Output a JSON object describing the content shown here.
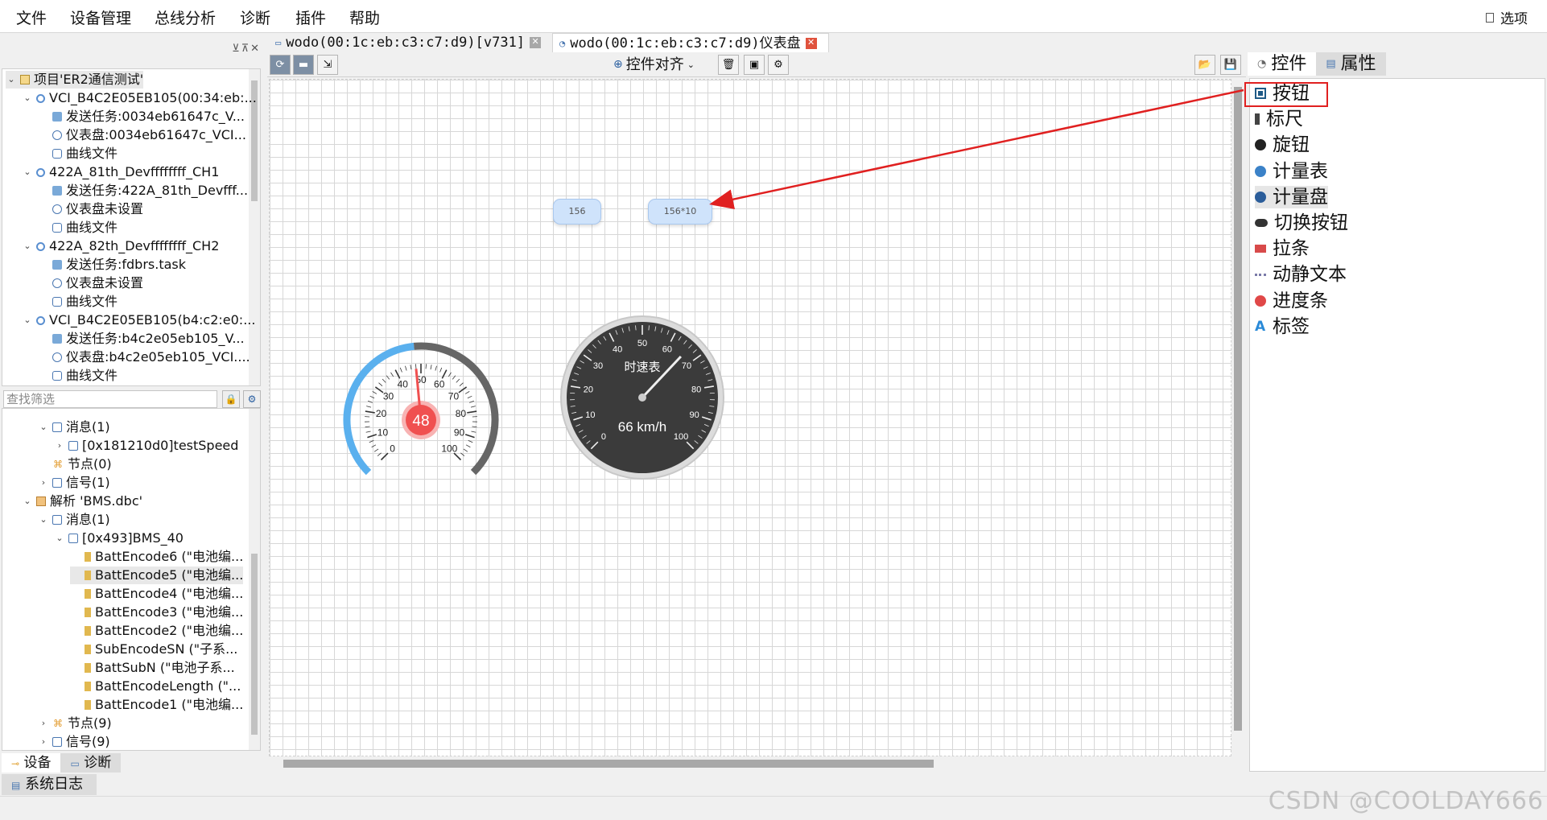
{
  "menu": [
    "文件",
    "设备管理",
    "总线分析",
    "诊断",
    "插件",
    "帮助"
  ],
  "menu_right": "选项",
  "tree_top": [
    {
      "label": "项目'ER2通信测试'",
      "icon": "folder-icon"
    },
    {
      "label": "VCI_B4C2E05EB105(00:34:eb:...",
      "icon": "link-icon"
    },
    {
      "label": "发送任务:0034eb61647c_V...",
      "icon": "task-icon"
    },
    {
      "label": "仪表盘:0034eb61647c_VCI...",
      "icon": "dashboard-icon"
    },
    {
      "label": "曲线文件",
      "icon": "curve-icon"
    },
    {
      "label": "422A_81th_Devffffffff_CH1",
      "icon": "link-icon"
    },
    {
      "label": "发送任务:422A_81th_Devfff...",
      "icon": "task-icon"
    },
    {
      "label": "仪表盘未设置",
      "icon": "dashboard-icon"
    },
    {
      "label": "曲线文件",
      "icon": "curve-icon"
    },
    {
      "label": "422A_82th_Devffffffff_CH2",
      "icon": "link-icon"
    },
    {
      "label": "发送任务:fdbrs.task",
      "icon": "task-icon"
    },
    {
      "label": "仪表盘未设置",
      "icon": "dashboard-icon"
    },
    {
      "label": "曲线文件",
      "icon": "curve-icon"
    },
    {
      "label": "VCI_B4C2E05EB105(b4:c2:e0:...",
      "icon": "link-icon"
    },
    {
      "label": "发送任务:b4c2e05eb105_V...",
      "icon": "task-icon"
    },
    {
      "label": "仪表盘:b4c2e05eb105_VCI....",
      "icon": "dashboard-icon"
    },
    {
      "label": "曲线文件",
      "icon": "curve-icon"
    }
  ],
  "filter_placeholder": "查找筛选",
  "tree_bottom": [
    {
      "label": "消息(1)",
      "icon": "message-icon"
    },
    {
      "label": "[0x181210d0]testSpeed",
      "icon": "envelope-icon"
    },
    {
      "label": "节点(0)",
      "icon": "node-icon"
    },
    {
      "label": "信号(1)",
      "icon": "envelope-icon"
    },
    {
      "label": "解析 'BMS.dbc'",
      "icon": "dbc-icon"
    },
    {
      "label": "消息(1)",
      "icon": "message-icon"
    },
    {
      "label": "[0x493]BMS_40",
      "icon": "envelope-icon"
    },
    {
      "label": "BattEncode6 (\"电池编...",
      "icon": "signal-icon"
    },
    {
      "label": "BattEncode5 (\"电池编...",
      "icon": "signal-icon"
    },
    {
      "label": "BattEncode4 (\"电池编...",
      "icon": "signal-icon"
    },
    {
      "label": "BattEncode3 (\"电池编...",
      "icon": "signal-icon"
    },
    {
      "label": "BattEncode2 (\"电池编...",
      "icon": "signal-icon"
    },
    {
      "label": "SubEncodeSN (\"子系...",
      "icon": "signal-icon"
    },
    {
      "label": "BattSubN (\"电池子系...",
      "icon": "signal-icon"
    },
    {
      "label": "BattEncodeLength (\"...",
      "icon": "signal-icon"
    },
    {
      "label": "BattEncode1 (\"电池编...",
      "icon": "signal-icon"
    },
    {
      "label": "节点(9)",
      "icon": "node-icon"
    },
    {
      "label": "信号(9)",
      "icon": "envelope-icon"
    }
  ],
  "bottom_tabs": [
    "设备",
    "诊断"
  ],
  "log_tab": "系统日志",
  "editor_tabs": [
    "wodo(00:1c:eb:c3:c7:d9)[v731]",
    "wodo(00:1c:eb:c3:c7:d9)仪表盘"
  ],
  "toolbar": {
    "align_label": "控件对齐"
  },
  "widgets": {
    "pill1": "156",
    "pill2": "156*10",
    "gauge1": {
      "value": "48",
      "value_num": 48,
      "ticks": [
        "0",
        "10",
        "20",
        "30",
        "40",
        "50",
        "60",
        "70",
        "80",
        "90",
        "100"
      ]
    },
    "gauge2": {
      "title": "时速表",
      "readout": "66 km/h",
      "value_num": 66,
      "ticks": [
        "0",
        "10",
        "20",
        "30",
        "40",
        "50",
        "60",
        "70",
        "80",
        "90",
        "100"
      ]
    }
  },
  "right_tabs": [
    "控件",
    "属性"
  ],
  "controls": [
    {
      "label": "按钮",
      "icon": "button-icon"
    },
    {
      "label": "标尺",
      "icon": "ruler-icon"
    },
    {
      "label": "旋钮",
      "icon": "knob-icon"
    },
    {
      "label": "计量表",
      "icon": "meter-icon"
    },
    {
      "label": "计量盘",
      "icon": "gauge-icon"
    },
    {
      "label": "切换按钮",
      "icon": "toggle-icon"
    },
    {
      "label": "拉条",
      "icon": "slider-icon"
    },
    {
      "label": "动静文本",
      "icon": "text-icon"
    },
    {
      "label": "进度条",
      "icon": "progress-icon"
    },
    {
      "label": "标签",
      "icon": "label-icon"
    }
  ],
  "watermark": "CSDN @COOLDAY666",
  "colors": {
    "accent": "#e02020",
    "gauge_blue": "#5ab0ee",
    "gauge_red": "#f05050",
    "dark_gauge": "#3b3b3b"
  }
}
